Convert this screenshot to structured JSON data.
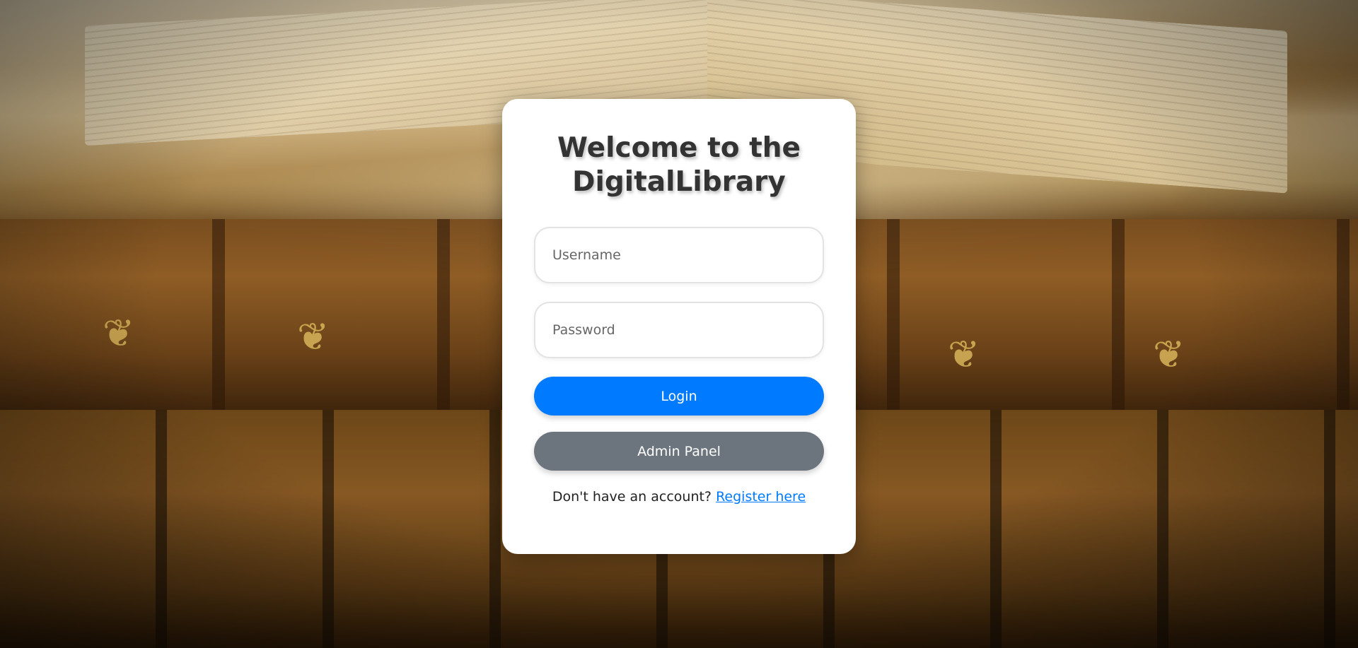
{
  "page": {
    "title_line1": "Welcome to the",
    "title_line2": "DigitalLibrary"
  },
  "form": {
    "username_placeholder": "Username",
    "username_value": "",
    "password_placeholder": "Password",
    "password_value": "",
    "login_label": "Login",
    "admin_label": "Admin Panel",
    "register_prompt": "Don't have an account?",
    "register_link": "Register here"
  },
  "colors": {
    "primary": "#007bff",
    "secondary": "#6c757d",
    "card_bg": "#ffffff",
    "title_text": "#333333"
  },
  "background": {
    "icon": "antique-books-photo"
  }
}
